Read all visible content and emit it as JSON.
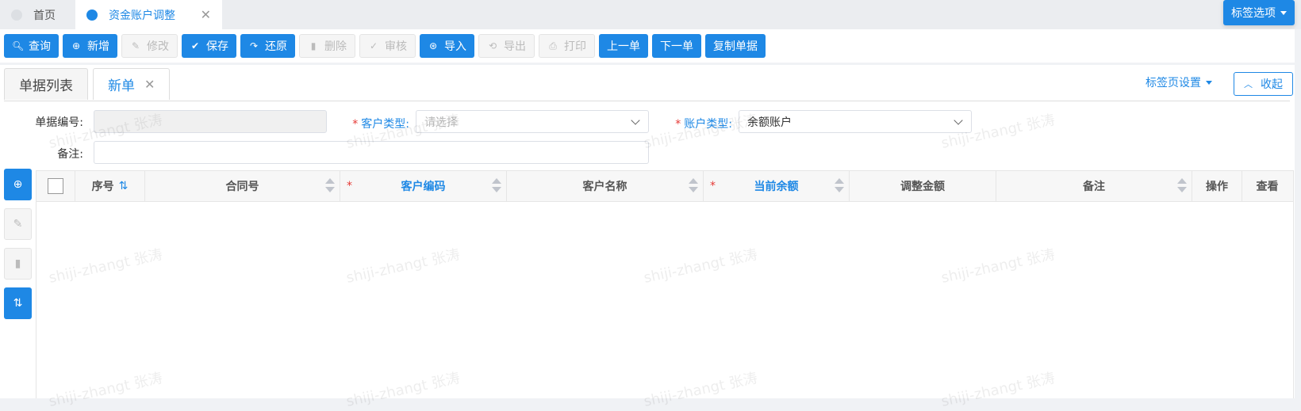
{
  "top_tabs": [
    {
      "label": "首页"
    },
    {
      "label": "资金账户调整"
    }
  ],
  "tag_options_label": "标签选项",
  "toolbar": [
    {
      "label": "查询",
      "icon": "search-icon",
      "state": "primary"
    },
    {
      "label": "新增",
      "icon": "plus-circle-icon",
      "state": "primary"
    },
    {
      "label": "修改",
      "icon": "pencil-icon",
      "state": "disabled"
    },
    {
      "label": "保存",
      "icon": "check-icon",
      "state": "primary"
    },
    {
      "label": "还原",
      "icon": "redo-icon",
      "state": "primary"
    },
    {
      "label": "删除",
      "icon": "trash-icon",
      "state": "disabled"
    },
    {
      "label": "审核",
      "icon": "double-check-icon",
      "state": "disabled"
    },
    {
      "label": "导入",
      "icon": "import-icon",
      "state": "primary"
    },
    {
      "label": "导出",
      "icon": "export-icon",
      "state": "disabled"
    },
    {
      "label": "打印",
      "icon": "printer-icon",
      "state": "disabled"
    },
    {
      "label": "上一单",
      "icon": "",
      "state": "primary"
    },
    {
      "label": "下一单",
      "icon": "",
      "state": "primary"
    },
    {
      "label": "复制单据",
      "icon": "",
      "state": "primary"
    }
  ],
  "sub_tabs": [
    {
      "label": "单据列表"
    },
    {
      "label": "新单"
    }
  ],
  "tab_settings_label": "标签页设置",
  "collapse_label": "收起",
  "form": {
    "doc_no_label": "单据编号:",
    "doc_no_value": "",
    "customer_type_label": "客户类型:",
    "customer_type_placeholder": "请选择",
    "account_type_label": "账户类型:",
    "account_type_value": "余额账户",
    "remark_label": "备注:",
    "remark_value": ""
  },
  "grid_columns": [
    "序号",
    "合同号",
    "客户编码",
    "客户名称",
    "当前余额",
    "调整金额",
    "备注",
    "操作",
    "查看"
  ],
  "watermark": "shiji-zhangt 张涛",
  "colors": {
    "primary": "#1e88e5",
    "required": "#e53935"
  }
}
